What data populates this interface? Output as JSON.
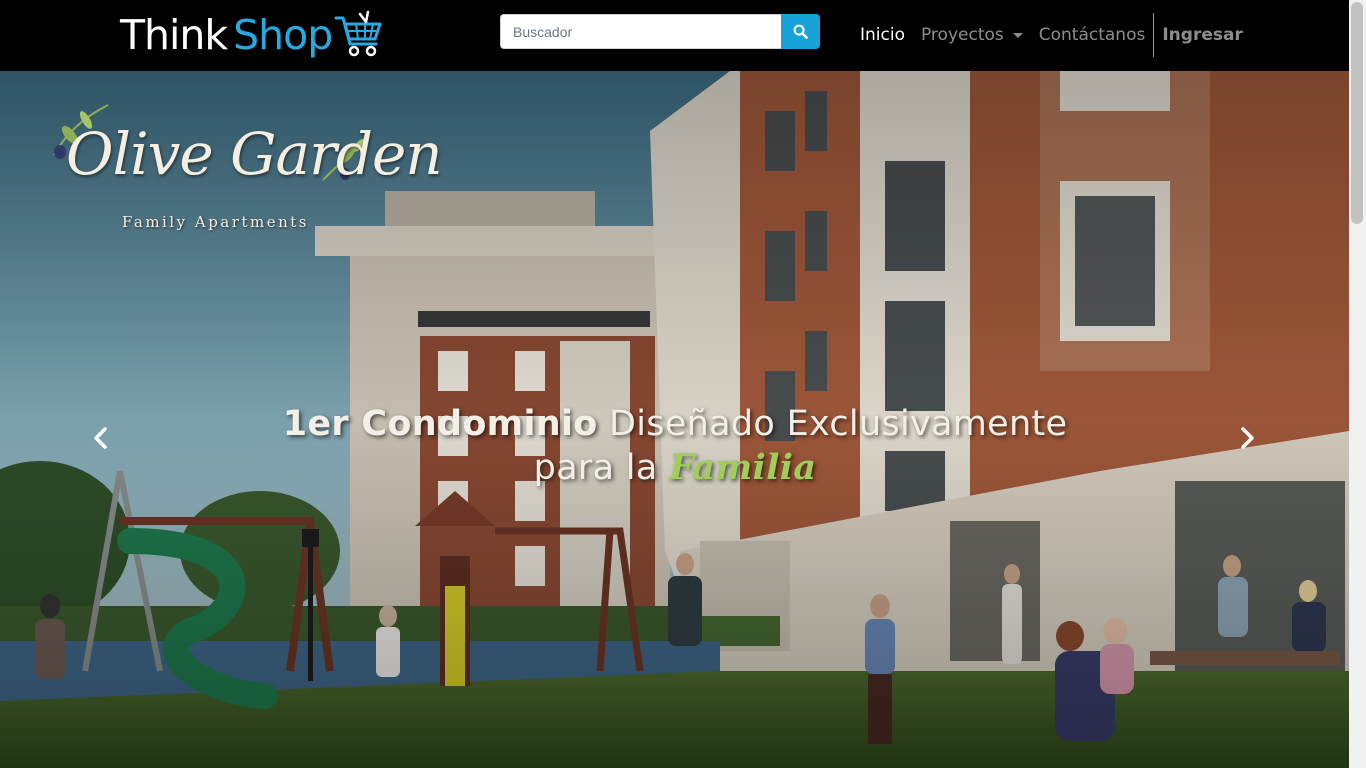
{
  "brand": {
    "think": "Think",
    "shop": "Shop",
    "cart_icon": "shopping-cart-icon"
  },
  "search": {
    "placeholder": "Buscador",
    "value": "",
    "icon": "search-icon"
  },
  "nav": {
    "inicio": "Inicio",
    "proyectos": "Proyectos",
    "contactanos": "Contáctanos",
    "ingresar": "Ingresar"
  },
  "hero": {
    "logo_title": "Olive Garden",
    "logo_subtitle": "Family Apartments",
    "headline_bold": "1er Condominio",
    "headline_rest": " Diseñado Exclusivamente",
    "headline_line2": "para la ",
    "headline_highlight": "Familia",
    "prev_icon": "chevron-left-icon",
    "next_icon": "chevron-right-icon"
  },
  "colors": {
    "brand_blue": "#27a9e1",
    "search_button": "#17a2d8",
    "highlight_green": "#9fce5a"
  }
}
